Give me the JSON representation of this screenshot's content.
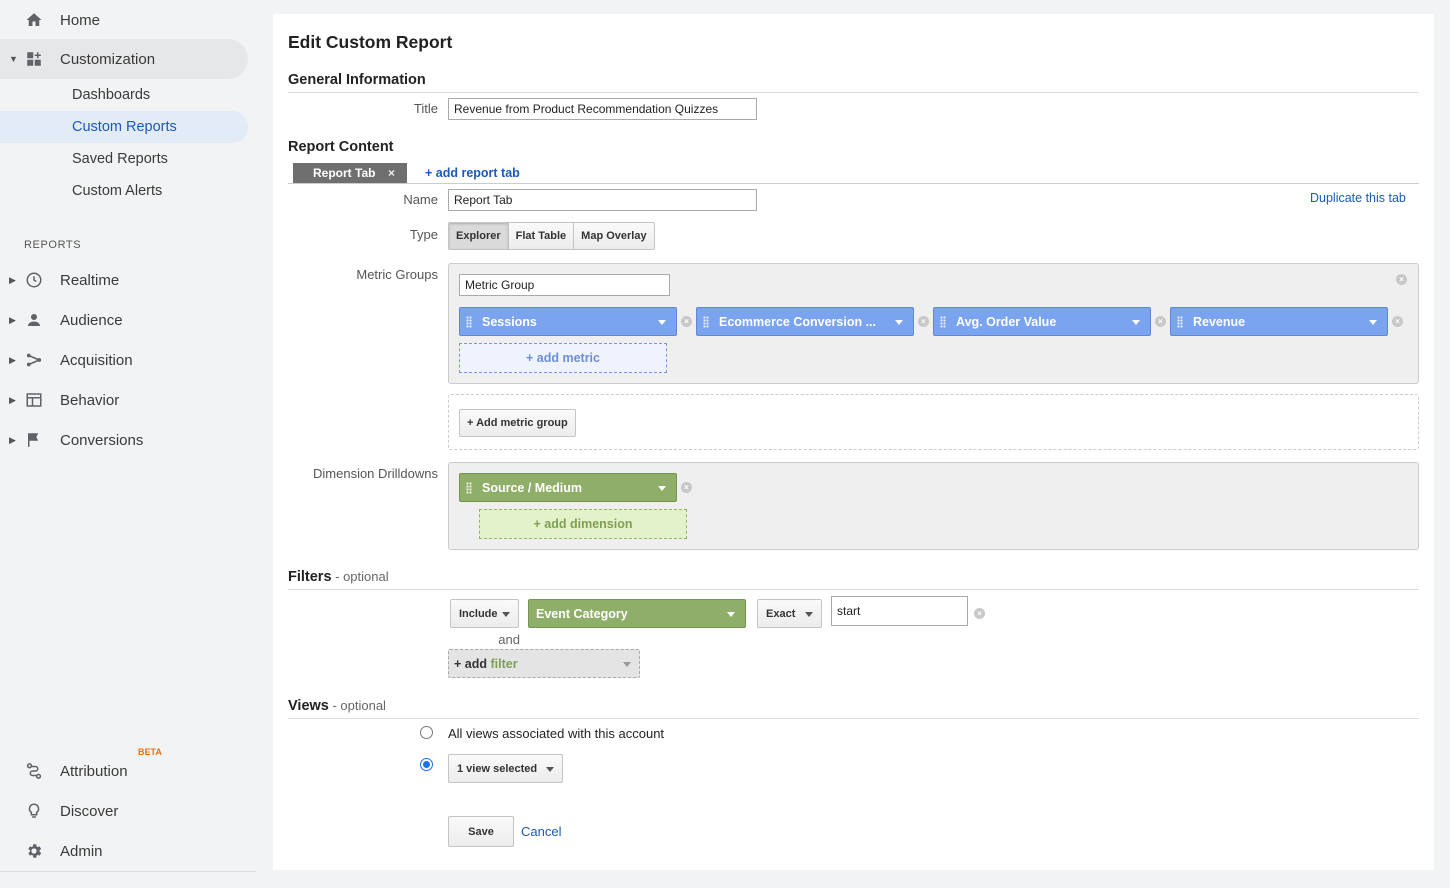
{
  "sidebar": {
    "top_items": [
      {
        "label": "Home"
      },
      {
        "label": "Customization"
      }
    ],
    "customization_subitems": [
      {
        "label": "Dashboards"
      },
      {
        "label": "Custom Reports"
      },
      {
        "label": "Saved Reports"
      },
      {
        "label": "Custom Alerts"
      }
    ],
    "reports_heading": "REPORTS",
    "report_items": [
      {
        "label": "Realtime"
      },
      {
        "label": "Audience"
      },
      {
        "label": "Acquisition"
      },
      {
        "label": "Behavior"
      },
      {
        "label": "Conversions"
      }
    ],
    "bottom_items": [
      {
        "label": "Attribution",
        "badge": "BETA"
      },
      {
        "label": "Discover"
      },
      {
        "label": "Admin"
      }
    ]
  },
  "page": {
    "title": "Edit Custom Report",
    "general_info": {
      "heading": "General Information",
      "title_label": "Title",
      "title_value": "Revenue from Product Recommendation Quizzes"
    },
    "report_content": {
      "heading": "Report Content",
      "tab_label": "Report Tab",
      "tab_close": "×",
      "add_tab": "+ add report tab",
      "duplicate_tab": "Duplicate this tab",
      "name_label": "Name",
      "name_value": "Report Tab",
      "type_label": "Type",
      "types": [
        "Explorer",
        "Flat Table",
        "Map Overlay"
      ],
      "selected_type": "Explorer",
      "metric_groups_label": "Metric Groups",
      "metric_group_name": "Metric Group",
      "metrics": [
        "Sessions",
        "Ecommerce Conversion ...",
        "Avg. Order Value",
        "Revenue"
      ],
      "add_metric": "+ add metric",
      "add_metric_group": "+ Add metric group",
      "dimension_label": "Dimension Drilldowns",
      "dimensions": [
        "Source / Medium"
      ],
      "add_dimension": "+ add dimension"
    },
    "filters": {
      "heading": "Filters",
      "optional": " - optional",
      "include": "Include",
      "dimension": "Event Category",
      "match_type": "Exact",
      "value": "start",
      "and_label": "and",
      "add_filter_prefix": "+ add",
      "add_filter_word": "filter"
    },
    "views": {
      "heading": "Views",
      "optional": " - optional",
      "all_views_label": "All views associated with this account",
      "selected_views": "1 view selected",
      "selected_option": "selected_views"
    },
    "actions": {
      "save": "Save",
      "cancel": "Cancel"
    }
  },
  "colors": {
    "metric_chip": "#7aa3f0",
    "dimension_chip": "#8fae6a",
    "link": "#1a5ab8",
    "active_nav_bg": "#e3ebf7",
    "beta": "#e8710a"
  }
}
